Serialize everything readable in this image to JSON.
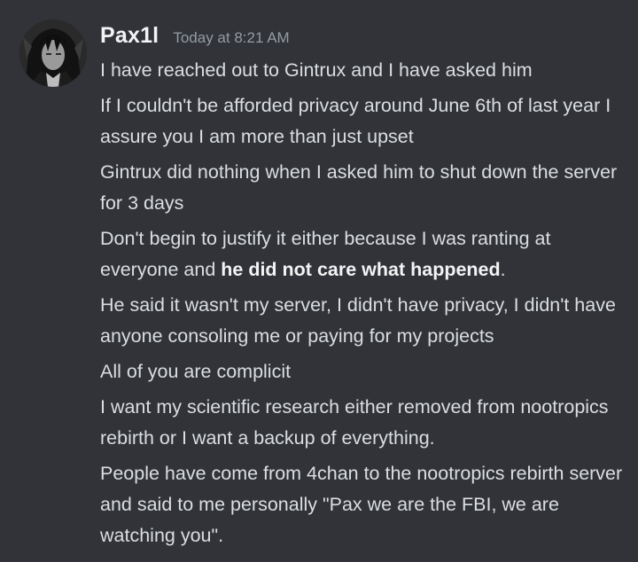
{
  "author": {
    "name": "Pax1l",
    "timestamp": "Today at 8:21 AM",
    "avatar_icon": "user-avatar"
  },
  "messages": [
    {
      "text": "I have reached out to Gintrux and I have asked him"
    },
    {
      "text": "If I couldn't be afforded privacy around June 6th of last year I assure you I am more than just upset"
    },
    {
      "text": "Gintrux did nothing when I asked him to shut down the server for 3 days"
    },
    {
      "text_before": "Don't begin to justify it either because I was ranting at everyone and ",
      "text_bold": "he did not care what happened",
      "text_after": "."
    },
    {
      "text": "He said it wasn't my server, I didn't have privacy, I didn't have anyone consoling me or paying for my projects"
    },
    {
      "text": "All of you are complicit"
    },
    {
      "text": "I want my scientific research either removed from nootropics rebirth or I want a backup of everything."
    },
    {
      "text": "People have come from 4chan to the nootropics rebirth server and said to me personally \"Pax we are the FBI, we are watching you\"."
    }
  ],
  "colors": {
    "background": "#313338",
    "username": "#f2f3f5",
    "timestamp": "#949ba4",
    "message_text": "#dbdee1"
  }
}
